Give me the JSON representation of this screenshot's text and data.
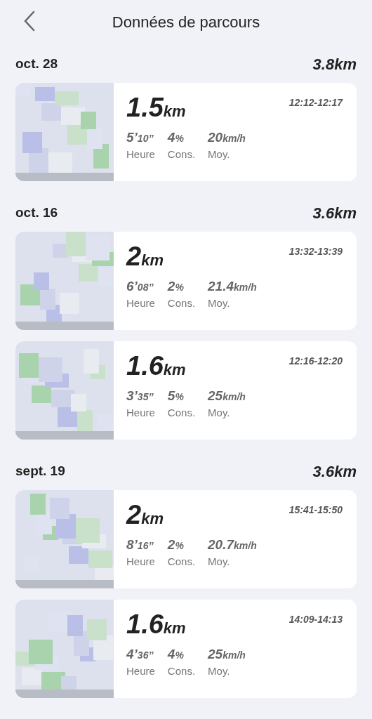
{
  "header": {
    "title": "Données de parcours"
  },
  "days": [
    {
      "date": "oct. 28",
      "total": "3.8km",
      "rides": [
        {
          "distance": "1.5",
          "distance_unit": "km",
          "time_range": "12:12-12:17",
          "stats": [
            {
              "value": "5’",
              "unit": "10’’",
              "label": "Heure"
            },
            {
              "value": "4",
              "unit": "%",
              "label": "Cons."
            },
            {
              "value": "20",
              "unit": "km/h",
              "label": "Moy."
            }
          ]
        }
      ]
    },
    {
      "date": "oct. 16",
      "total": "3.6km",
      "rides": [
        {
          "distance": "2",
          "distance_unit": "km",
          "time_range": "13:32-13:39",
          "stats": [
            {
              "value": "6’",
              "unit": "08’’",
              "label": "Heure"
            },
            {
              "value": "2",
              "unit": "%",
              "label": "Cons."
            },
            {
              "value": "21.4",
              "unit": "km/h",
              "label": "Moy."
            }
          ]
        },
        {
          "distance": "1.6",
          "distance_unit": "km",
          "time_range": "12:16-12:20",
          "stats": [
            {
              "value": "3’",
              "unit": "35’’",
              "label": "Heure"
            },
            {
              "value": "5",
              "unit": "%",
              "label": "Cons."
            },
            {
              "value": "25",
              "unit": "km/h",
              "label": "Moy."
            }
          ]
        }
      ]
    },
    {
      "date": "sept. 19",
      "total": "3.6km",
      "rides": [
        {
          "distance": "2",
          "distance_unit": "km",
          "time_range": "15:41-15:50",
          "stats": [
            {
              "value": "8’",
              "unit": "16’’",
              "label": "Heure"
            },
            {
              "value": "2",
              "unit": "%",
              "label": "Cons."
            },
            {
              "value": "20.7",
              "unit": "km/h",
              "label": "Moy."
            }
          ]
        },
        {
          "distance": "1.6",
          "distance_unit": "km",
          "time_range": "14:09-14:13",
          "stats": [
            {
              "value": "4’",
              "unit": "36’’",
              "label": "Heure"
            },
            {
              "value": "4",
              "unit": "%",
              "label": "Cons."
            },
            {
              "value": "25",
              "unit": "km/h",
              "label": "Moy."
            }
          ]
        }
      ]
    }
  ]
}
